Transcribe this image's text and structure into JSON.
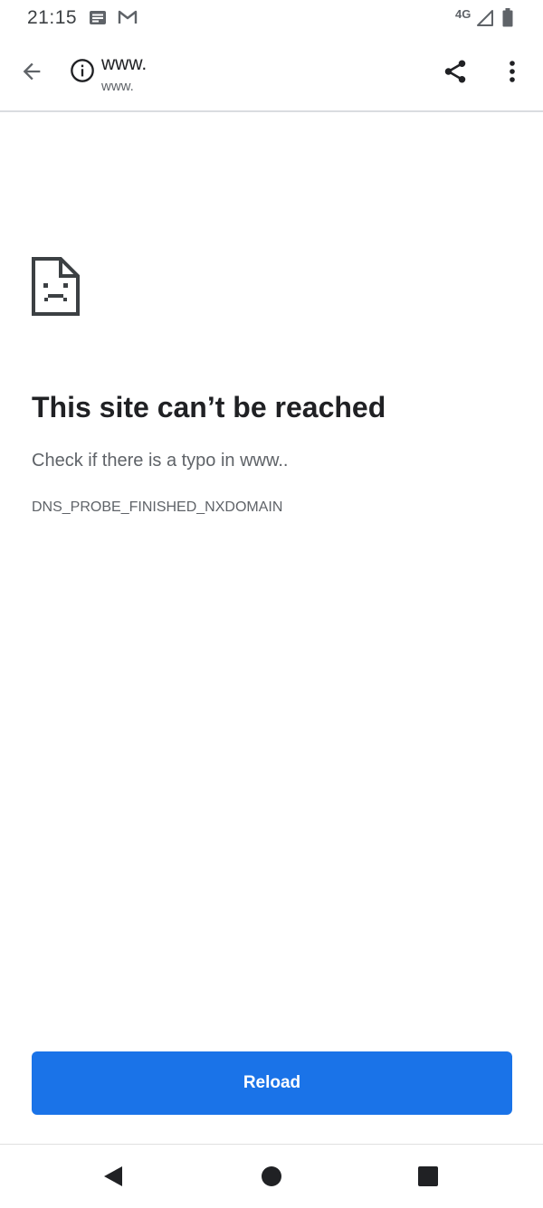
{
  "status_bar": {
    "time": "21:15",
    "network": "4G",
    "notification_icons": [
      "newspaper-icon",
      "gmail-icon"
    ]
  },
  "toolbar": {
    "title": "www.",
    "subtitle": "www.",
    "icons": [
      "back-arrow-icon",
      "info-icon",
      "share-icon",
      "more-vert-icon"
    ]
  },
  "error": {
    "icon": "sad-page-icon",
    "title": "This site can’t be reached",
    "description": "Check if there is a typo in www..",
    "code": "DNS_PROBE_FINISHED_NXDOMAIN"
  },
  "reload_button": {
    "label": "Reload",
    "color": "#1a73e8"
  },
  "nav_bar": {
    "icons": [
      "nav-back-icon",
      "nav-home-icon",
      "nav-recents-icon"
    ]
  }
}
